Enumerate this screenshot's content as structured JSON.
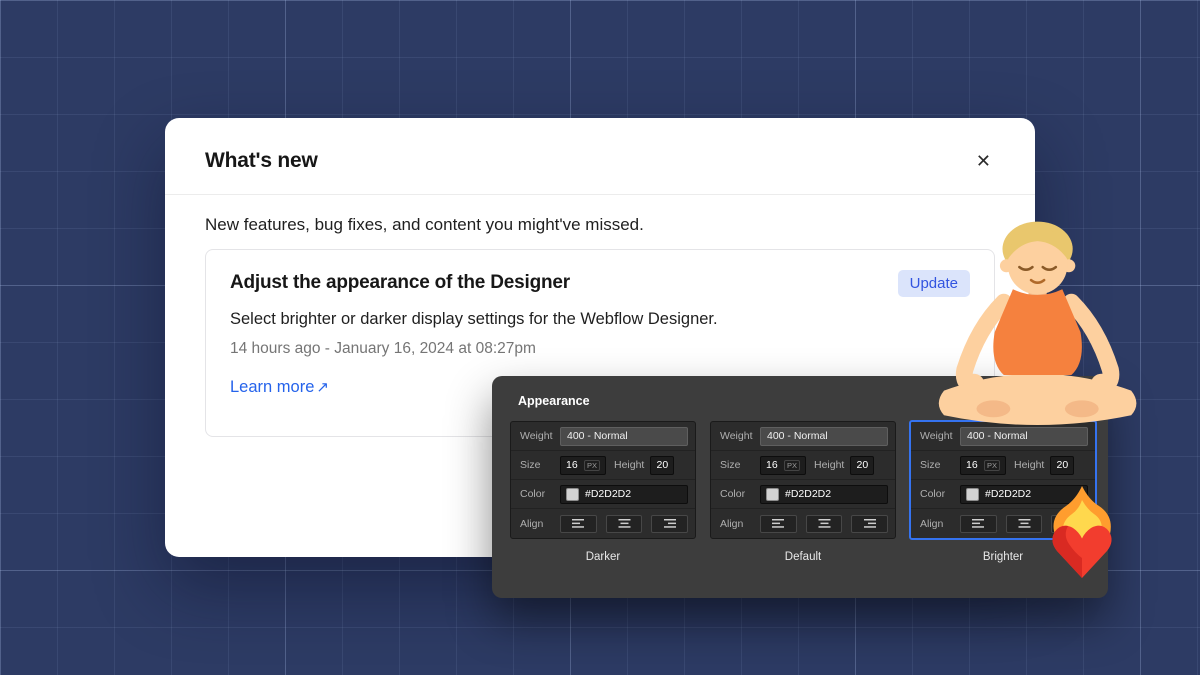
{
  "modal": {
    "title": "What's new",
    "close_glyph": "✕",
    "subtitle": "New features, bug fixes, and content you might've missed.",
    "card": {
      "title": "Adjust the appearance of the Designer",
      "badge": "Update",
      "description": "Select brighter or darker display settings for the Webflow Designer.",
      "timestamp": "14 hours ago - January 16, 2024 at 08:27pm",
      "link_label": "Learn more",
      "link_arrow": "↗"
    }
  },
  "appearance_panel": {
    "title": "Appearance",
    "fields": {
      "weight_label": "Weight",
      "weight_value": "400 - Normal",
      "size_label": "Size",
      "size_value": "16",
      "size_unit": "PX",
      "height_label": "Height",
      "height_value": "20",
      "color_label": "Color",
      "color_value": "#D2D2D2",
      "align_label": "Align"
    },
    "options": [
      {
        "label": "Darker",
        "selected": false
      },
      {
        "label": "Default",
        "selected": false
      },
      {
        "label": "Brighter",
        "selected": true
      }
    ]
  },
  "icons": {
    "close": "✕",
    "link_arrow": "↗",
    "align": [
      "align-left",
      "align-center",
      "align-right"
    ],
    "emojis": [
      "person-in-lotus-position",
      "heart-on-fire"
    ]
  },
  "colors": {
    "background": "#2d3b64",
    "accent_blue": "#3573f0",
    "badge_bg": "#dbe4fb",
    "badge_text": "#3254e0",
    "link": "#2563eb",
    "swatch": "#D2D2D2",
    "panel_bg": "#3d3d3d"
  }
}
